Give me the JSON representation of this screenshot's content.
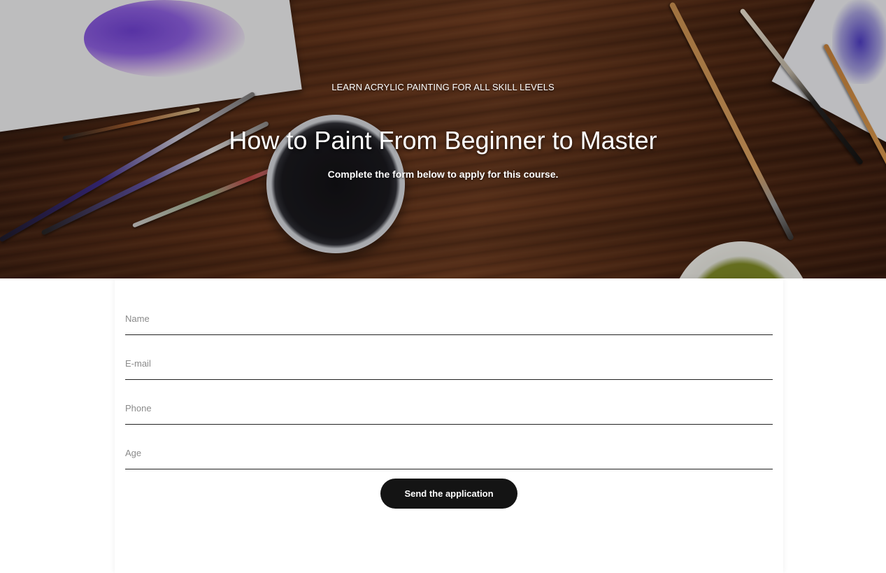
{
  "hero": {
    "eyebrow": "LEARN ACRYLIC PAINTING FOR ALL SKILL LEVELS",
    "title": "How to Paint From Beginner to Master",
    "subtitle": "Complete the form below to apply for this course."
  },
  "form": {
    "fields": [
      {
        "placeholder": "Name",
        "value": ""
      },
      {
        "placeholder": "E-mail",
        "value": ""
      },
      {
        "placeholder": "Phone",
        "value": ""
      },
      {
        "placeholder": "Age",
        "value": ""
      }
    ],
    "submit_label": "Send the application"
  },
  "colors": {
    "button_bg": "#141414",
    "field_underline": "#222222",
    "placeholder": "#8a8a8a"
  }
}
